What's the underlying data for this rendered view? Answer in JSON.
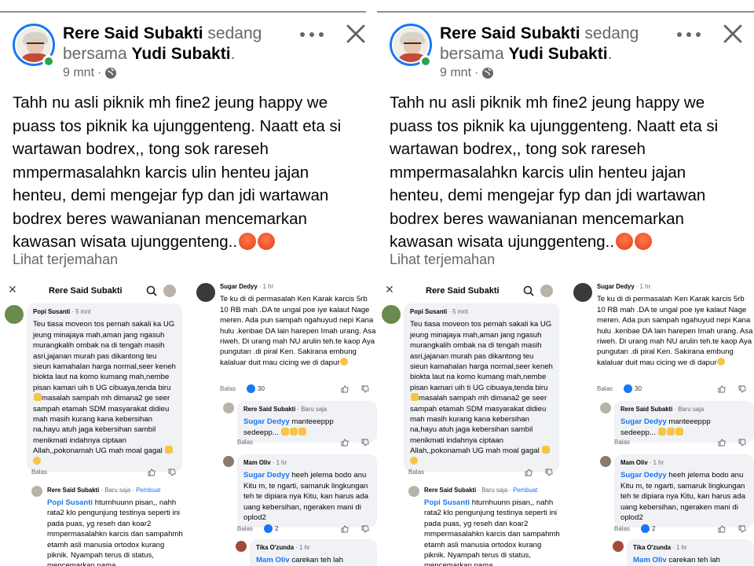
{
  "post": {
    "author": "Rere Said Subakti",
    "with_word": "sedang",
    "with_prefix": "bersama",
    "tagged": "Yudi Subakti",
    "tagged_suffix": ".",
    "time": "9 mnt",
    "time_sep": "·",
    "text": "Tahh nu asli piknik mh fine2 jeung happy we puass tos piknik ka ujunggenteng. Naatt eta si wartawan bodrex,, tong sok rareseh mmpermasalahkn karcis ulin henteu jajan henteu, demi mengejar fyp dan jdi wartawan bodrex beres wawanianan mencemarkan kawasan wisata ujunggenteng..",
    "translate": "Lihat terjemahan"
  },
  "shot_a": {
    "header_title": "Rere Said Subakti",
    "c1_name": "Popi Susanti",
    "c1_time": "· 5 mnt",
    "c1_text_1": "Teu tiasa moveon tos pernah sakali ka UG jeung minajaya mah,aman jang ngasuh murangkalih ombak na di tengah masih asri,jajanan murah pas dikantong teu sieun kamahalan harga normal,seer keneh biokta laut na komo kumang mah,nembe pisan kamari uih ti UG cibuaya,tenda biru",
    "c1_text_2": "masalah sampah mh dimana2 ge seer sampah etamah SDM masyarakat didieu mah masih kurang kana kebersihan na,hayu atuh jaga kebersihan sambil menikmati indahnya ciptaan Allah,,pokonamah UG mah moal gagal",
    "c1_reply": "Balas",
    "c2_name": "Rere Said Subakti",
    "c2_time": "· Baru saja ·",
    "c2_pin": "Pembuat",
    "c2_mention": "Popi Susanti",
    "c2_text": "hturnhuunn pisan,, nahh rata2 klo pengunjung testinya seperti ini pada puas, yg reseh dan koar2 mmpermasalahkn karcis dan sampahmh etamh asli manusia ortodox kurang piknik. Nyampah terus di status, mencemarkan nama"
  },
  "shot_b": {
    "c1_name": "Sugar Dedyy",
    "c1_time": "· 1 hr",
    "c1_text": "Te ku di di permasalah Ken Karak karcis 5rb 10 RB mah .DA te ungal poe iye kalaut Nage meren. Ada pun sampah ngahuyud nepi Kana hulu .kenbae DA lain harepen Imah urang. Asa riweh. Di urang mah NU arulin teh.te kaop Aya pungutan .di piral Ken. Sakirana embung kalaluar duit mau cicing we di dapur",
    "c1_reply": "Balas",
    "c1_count": "30",
    "c2_name": "Rere Said Subakti",
    "c2_time": "· Baru saja",
    "c2_mention": "Sugar Dedyy",
    "c2_text": "manteeeppp sedeepp...",
    "c2_reply": "Balas",
    "c3_name": "Mam Oliv",
    "c3_time": "· 1 hr",
    "c3_mention": "Sugar Dedyy",
    "c3_text": "heeh jelema bodo anu Kitu m, te ngarti, samaruk lingkungan teh te dipiara nya Kitu, kan harus ada uang kebersihan, ngeraken mani di oplod2",
    "c3_reply": "Balas",
    "c3_count": "2",
    "c4_name": "Tika O'zunda",
    "c4_time": "· 1 hr",
    "c4_mention": "Mam Oliv",
    "c4_text": "carekan teh lah"
  },
  "icons": [
    "more-icon",
    "close-icon",
    "globe-icon",
    "search-icon",
    "like-icon",
    "dislike-icon",
    "angry-emoji-icon"
  ]
}
